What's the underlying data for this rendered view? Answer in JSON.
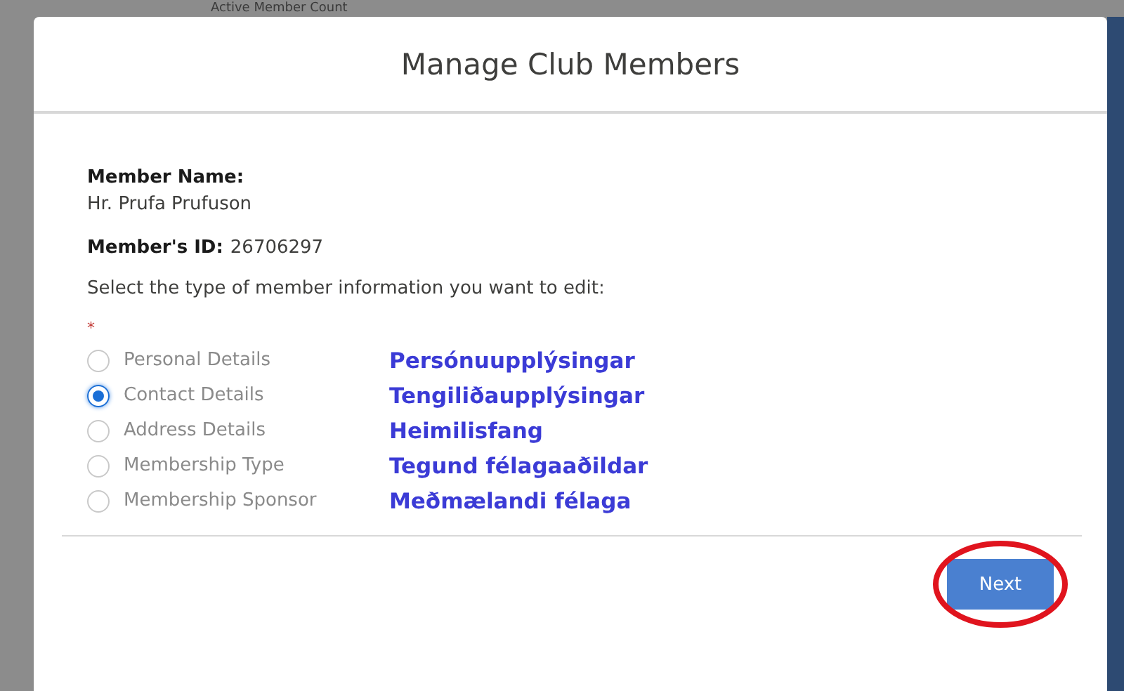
{
  "background": {
    "label": "Active Member Count"
  },
  "modal": {
    "title": "Manage Club Members",
    "member_name_label": "Member Name:",
    "member_name": "Hr. Prufa Prufuson",
    "member_id_label": "Member's ID:",
    "member_id": "26706297",
    "prompt": "Select the type of member information you want to edit:",
    "required_mark": "*",
    "options": [
      {
        "label": "Personal Details",
        "translation": "Persónuupplýsingar",
        "selected": false
      },
      {
        "label": "Contact Details",
        "translation": "Tengiliðaupplýsingar",
        "selected": true
      },
      {
        "label": "Address Details",
        "translation": "Heimilisfang",
        "selected": false
      },
      {
        "label": "Membership Type",
        "translation": "Tegund félagaaðildar",
        "selected": false
      },
      {
        "label": "Membership Sponsor",
        "translation": "Meðmælandi félaga",
        "selected": false
      }
    ],
    "next_button": "Next"
  }
}
